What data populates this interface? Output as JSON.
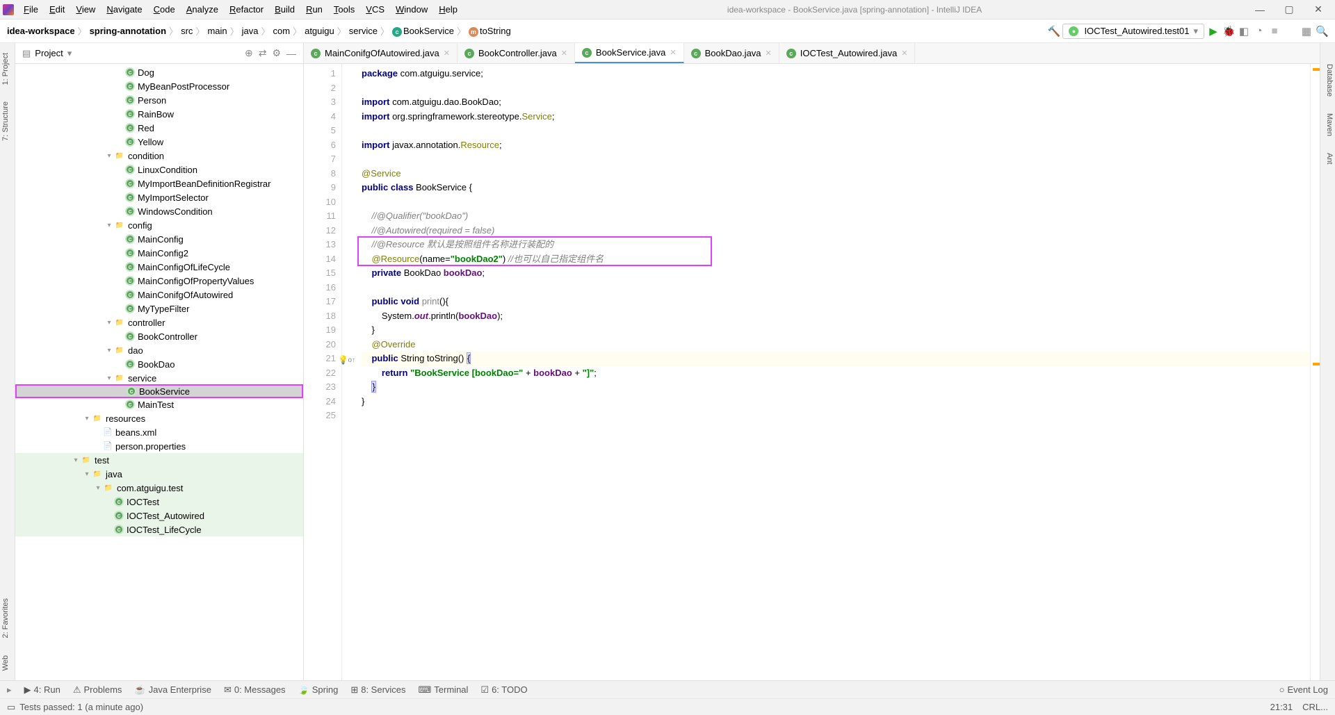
{
  "title": "idea-workspace - BookService.java [spring-annotation] - IntelliJ IDEA",
  "menus": [
    "File",
    "Edit",
    "View",
    "Navigate",
    "Code",
    "Analyze",
    "Refactor",
    "Build",
    "Run",
    "Tools",
    "VCS",
    "Window",
    "Help"
  ],
  "breadcrumbs": [
    "idea-workspace",
    "spring-annotation",
    "src",
    "main",
    "java",
    "com",
    "atguigu",
    "service",
    "BookService",
    "toString"
  ],
  "runConfig": "IOCTest_Autowired.test01",
  "projectTool": {
    "title": "Project"
  },
  "leftTabs": [
    "1: Project",
    "7: Structure",
    "2: Favorites",
    "Web"
  ],
  "rightTabs": [
    "Database",
    "Maven",
    "Ant"
  ],
  "tree": [
    {
      "d": 9,
      "i": "cls",
      "t": "Dog"
    },
    {
      "d": 9,
      "i": "cls",
      "t": "MyBeanPostProcessor"
    },
    {
      "d": 9,
      "i": "cls",
      "t": "Person"
    },
    {
      "d": 9,
      "i": "cls",
      "t": "RainBow"
    },
    {
      "d": 9,
      "i": "cls",
      "t": "Red"
    },
    {
      "d": 9,
      "i": "cls",
      "t": "Yellow"
    },
    {
      "d": 8,
      "a": "▾",
      "i": "fld",
      "t": "condition"
    },
    {
      "d": 9,
      "i": "cls",
      "t": "LinuxCondition"
    },
    {
      "d": 9,
      "i": "cls",
      "t": "MyImportBeanDefinitionRegistrar"
    },
    {
      "d": 9,
      "i": "cls",
      "t": "MyImportSelector"
    },
    {
      "d": 9,
      "i": "cls",
      "t": "WindowsCondition"
    },
    {
      "d": 8,
      "a": "▾",
      "i": "fld",
      "t": "config"
    },
    {
      "d": 9,
      "i": "cls",
      "t": "MainConfig"
    },
    {
      "d": 9,
      "i": "cls",
      "t": "MainConfig2"
    },
    {
      "d": 9,
      "i": "cls",
      "t": "MainConfigOfLifeCycle"
    },
    {
      "d": 9,
      "i": "cls",
      "t": "MainConfigOfPropertyValues"
    },
    {
      "d": 9,
      "i": "cls",
      "t": "MainConifgOfAutowired"
    },
    {
      "d": 9,
      "i": "cls",
      "t": "MyTypeFilter"
    },
    {
      "d": 8,
      "a": "▾",
      "i": "fld",
      "t": "controller"
    },
    {
      "d": 9,
      "i": "cls",
      "t": "BookController"
    },
    {
      "d": 8,
      "a": "▾",
      "i": "fld",
      "t": "dao"
    },
    {
      "d": 9,
      "i": "cls",
      "t": "BookDao"
    },
    {
      "d": 8,
      "a": "▾",
      "i": "fld",
      "t": "service"
    },
    {
      "d": 9,
      "i": "cls",
      "t": "BookService",
      "sel": true,
      "hl": true
    },
    {
      "d": 9,
      "i": "cls",
      "t": "MainTest"
    },
    {
      "d": 6,
      "a": "▾",
      "i": "fld",
      "t": "resources"
    },
    {
      "d": 7,
      "i": "xml",
      "t": "beans.xml"
    },
    {
      "d": 7,
      "i": "xml",
      "t": "person.properties"
    },
    {
      "d": 5,
      "a": "▾",
      "i": "fld",
      "t": "test",
      "test": true
    },
    {
      "d": 6,
      "a": "▾",
      "i": "fld",
      "t": "java",
      "test": true
    },
    {
      "d": 7,
      "a": "▾",
      "i": "fld",
      "t": "com.atguigu.test",
      "test": true
    },
    {
      "d": 8,
      "i": "cls",
      "t": "IOCTest",
      "test": true
    },
    {
      "d": 8,
      "i": "cls",
      "t": "IOCTest_Autowired",
      "test": true
    },
    {
      "d": 8,
      "i": "cls",
      "t": "IOCTest_LifeCycle",
      "test": true
    }
  ],
  "tabs": [
    {
      "label": "MainConifgOfAutowired.java"
    },
    {
      "label": "BookController.java"
    },
    {
      "label": "BookService.java",
      "active": true
    },
    {
      "label": "BookDao.java"
    },
    {
      "label": "IOCTest_Autowired.java"
    }
  ],
  "code": [
    {
      "n": 1,
      "h": "<span class='kw'>package</span> com.atguigu.service;"
    },
    {
      "n": 2,
      "h": ""
    },
    {
      "n": 3,
      "h": "<span class='kw'>import</span> com.atguigu.dao.BookDao;"
    },
    {
      "n": 4,
      "h": "<span class='kw'>import</span> org.springframework.stereotype.<span class='anno'>Service</span>;"
    },
    {
      "n": 5,
      "h": ""
    },
    {
      "n": 6,
      "h": "<span class='kw'>import</span> javax.annotation.<span class='anno'>Resource</span>;"
    },
    {
      "n": 7,
      "h": ""
    },
    {
      "n": 8,
      "h": "<span class='anno'>@Service</span>"
    },
    {
      "n": 9,
      "h": "<span class='kw'>public class</span> BookService {"
    },
    {
      "n": 10,
      "h": ""
    },
    {
      "n": 11,
      "h": "    <span class='cmt'>//@Qualifier(\"bookDao\")</span>"
    },
    {
      "n": 12,
      "h": "    <span class='cmt'>//@Autowired(required = false)</span>"
    },
    {
      "n": 13,
      "h": "    <span class='cmt'>//@Resource 默认是按照组件名称进行装配的</span>"
    },
    {
      "n": 14,
      "h": "    <span class='anno'>@Resource</span>(name=<span class='str'>\"bookDao2\"</span>) <span class='cmt'>//也可以自己指定组件名</span>"
    },
    {
      "n": 15,
      "h": "    <span class='kw'>private</span> BookDao <span class='fld'>bookDao</span>;"
    },
    {
      "n": 16,
      "h": ""
    },
    {
      "n": 17,
      "h": "    <span class='kw'>public void</span> <span class='method'>print</span>(){"
    },
    {
      "n": 18,
      "h": "        System.<span class='fld static'>out</span>.println(<span class='fld'>bookDao</span>);"
    },
    {
      "n": 19,
      "h": "    }"
    },
    {
      "n": 20,
      "h": "    <span class='anno'>@Override</span>"
    },
    {
      "n": 21,
      "h": "    <span class='kw'>public</span> String toString() <span class='brace-match'>{</span>",
      "caret": true,
      "bulb": true,
      "override": true
    },
    {
      "n": 22,
      "h": "        <span class='kw'>return</span> <span class='str'>\"BookService [bookDao=\"</span> + <span class='fld'>bookDao</span> + <span class='str'>\"]\"</span>;"
    },
    {
      "n": 23,
      "h": "    <span class='brace-match'>}</span>"
    },
    {
      "n": 24,
      "h": "}"
    },
    {
      "n": 25,
      "h": ""
    }
  ],
  "bottomTools": [
    "4: Run",
    "Problems",
    "Java Enterprise",
    "0: Messages",
    "Spring",
    "8: Services",
    "Terminal",
    "6: TODO"
  ],
  "eventLog": "Event Log",
  "status": {
    "msg": "Tests passed: 1 (a minute ago)",
    "pos": "21:31",
    "enc": "CRL..."
  }
}
